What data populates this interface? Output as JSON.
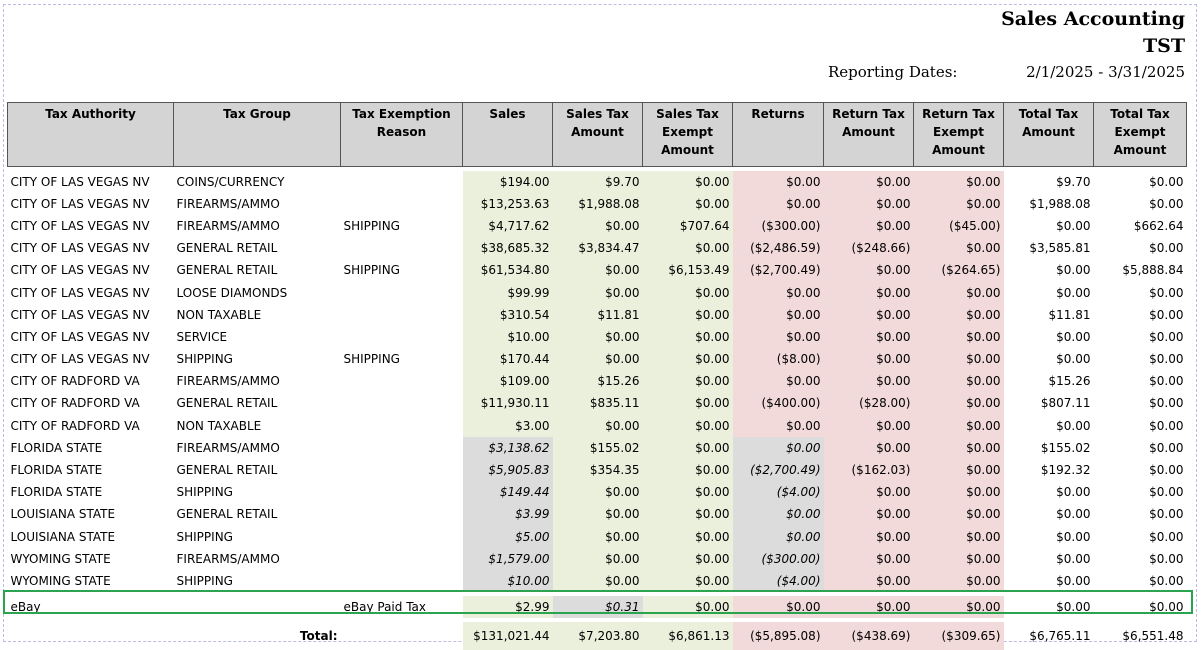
{
  "header": {
    "title": "Sales Accounting",
    "subtitle": "TST",
    "reporting_label": "Reporting Dates:",
    "reporting_dates": "2/1/2025 - 3/31/2025"
  },
  "columns": {
    "authority": "Tax Authority",
    "group": "Tax Group",
    "reason": "Tax Exemption Reason",
    "sales": "Sales",
    "sales_tax": "Sales Tax Amount",
    "sales_exempt": "Sales Tax Exempt Amount",
    "returns": "Returns",
    "return_tax": "Return Tax Amount",
    "return_exempt": "Return Tax Exempt Amount",
    "total_tax": "Total Tax Amount",
    "total_exempt": "Total Tax Exempt Amount"
  },
  "rows": [
    {
      "authority": "CITY OF LAS VEGAS NV",
      "group": "COINS/CURRENCY",
      "reason": "",
      "sales": "$194.00",
      "sales_tax": "$9.70",
      "sales_exempt": "$0.00",
      "returns": "$0.00",
      "return_tax": "$0.00",
      "return_exempt": "$0.00",
      "total_tax": "$9.70",
      "total_exempt": "$0.00",
      "style": "city"
    },
    {
      "authority": "CITY OF LAS VEGAS NV",
      "group": "FIREARMS/AMMO",
      "reason": "",
      "sales": "$13,253.63",
      "sales_tax": "$1,988.08",
      "sales_exempt": "$0.00",
      "returns": "$0.00",
      "return_tax": "$0.00",
      "return_exempt": "$0.00",
      "total_tax": "$1,988.08",
      "total_exempt": "$0.00",
      "style": "city"
    },
    {
      "authority": "CITY OF LAS VEGAS NV",
      "group": "FIREARMS/AMMO",
      "reason": "SHIPPING",
      "sales": "$4,717.62",
      "sales_tax": "$0.00",
      "sales_exempt": "$707.64",
      "returns": "($300.00)",
      "return_tax": "$0.00",
      "return_exempt": "($45.00)",
      "total_tax": "$0.00",
      "total_exempt": "$662.64",
      "style": "city"
    },
    {
      "authority": "CITY OF LAS VEGAS NV",
      "group": "GENERAL RETAIL",
      "reason": "",
      "sales": "$38,685.32",
      "sales_tax": "$3,834.47",
      "sales_exempt": "$0.00",
      "returns": "($2,486.59)",
      "return_tax": "($248.66)",
      "return_exempt": "$0.00",
      "total_tax": "$3,585.81",
      "total_exempt": "$0.00",
      "style": "city"
    },
    {
      "authority": "CITY OF LAS VEGAS NV",
      "group": "GENERAL RETAIL",
      "reason": "SHIPPING",
      "sales": "$61,534.80",
      "sales_tax": "$0.00",
      "sales_exempt": "$6,153.49",
      "returns": "($2,700.49)",
      "return_tax": "$0.00",
      "return_exempt": "($264.65)",
      "total_tax": "$0.00",
      "total_exempt": "$5,888.84",
      "style": "city"
    },
    {
      "authority": "CITY OF LAS VEGAS NV",
      "group": "LOOSE DIAMONDS",
      "reason": "",
      "sales": "$99.99",
      "sales_tax": "$0.00",
      "sales_exempt": "$0.00",
      "returns": "$0.00",
      "return_tax": "$0.00",
      "return_exempt": "$0.00",
      "total_tax": "$0.00",
      "total_exempt": "$0.00",
      "style": "city"
    },
    {
      "authority": "CITY OF LAS VEGAS NV",
      "group": "NON TAXABLE",
      "reason": "",
      "sales": "$310.54",
      "sales_tax": "$11.81",
      "sales_exempt": "$0.00",
      "returns": "$0.00",
      "return_tax": "$0.00",
      "return_exempt": "$0.00",
      "total_tax": "$11.81",
      "total_exempt": "$0.00",
      "style": "city"
    },
    {
      "authority": "CITY OF LAS VEGAS NV",
      "group": "SERVICE",
      "reason": "",
      "sales": "$10.00",
      "sales_tax": "$0.00",
      "sales_exempt": "$0.00",
      "returns": "$0.00",
      "return_tax": "$0.00",
      "return_exempt": "$0.00",
      "total_tax": "$0.00",
      "total_exempt": "$0.00",
      "style": "city"
    },
    {
      "authority": "CITY OF LAS VEGAS NV",
      "group": "SHIPPING",
      "reason": "SHIPPING",
      "sales": "$170.44",
      "sales_tax": "$0.00",
      "sales_exempt": "$0.00",
      "returns": "($8.00)",
      "return_tax": "$0.00",
      "return_exempt": "$0.00",
      "total_tax": "$0.00",
      "total_exempt": "$0.00",
      "style": "city"
    },
    {
      "authority": "CITY OF RADFORD VA",
      "group": "FIREARMS/AMMO",
      "reason": "",
      "sales": "$109.00",
      "sales_tax": "$15.26",
      "sales_exempt": "$0.00",
      "returns": "$0.00",
      "return_tax": "$0.00",
      "return_exempt": "$0.00",
      "total_tax": "$15.26",
      "total_exempt": "$0.00",
      "style": "city"
    },
    {
      "authority": "CITY OF RADFORD VA",
      "group": "GENERAL RETAIL",
      "reason": "",
      "sales": "$11,930.11",
      "sales_tax": "$835.11",
      "sales_exempt": "$0.00",
      "returns": "($400.00)",
      "return_tax": "($28.00)",
      "return_exempt": "$0.00",
      "total_tax": "$807.11",
      "total_exempt": "$0.00",
      "style": "city"
    },
    {
      "authority": "CITY OF RADFORD VA",
      "group": "NON TAXABLE",
      "reason": "",
      "sales": "$3.00",
      "sales_tax": "$0.00",
      "sales_exempt": "$0.00",
      "returns": "$0.00",
      "return_tax": "$0.00",
      "return_exempt": "$0.00",
      "total_tax": "$0.00",
      "total_exempt": "$0.00",
      "style": "city"
    },
    {
      "authority": "FLORIDA STATE",
      "group": "FIREARMS/AMMO",
      "reason": "",
      "sales": "$3,138.62",
      "sales_tax": "$155.02",
      "sales_exempt": "$0.00",
      "returns": "$0.00",
      "return_tax": "$0.00",
      "return_exempt": "$0.00",
      "total_tax": "$155.02",
      "total_exempt": "$0.00",
      "style": "state"
    },
    {
      "authority": "FLORIDA STATE",
      "group": "GENERAL RETAIL",
      "reason": "",
      "sales": "$5,905.83",
      "sales_tax": "$354.35",
      "sales_exempt": "$0.00",
      "returns": "($2,700.49)",
      "return_tax": "($162.03)",
      "return_exempt": "$0.00",
      "total_tax": "$192.32",
      "total_exempt": "$0.00",
      "style": "state"
    },
    {
      "authority": "FLORIDA STATE",
      "group": "SHIPPING",
      "reason": "",
      "sales": "$149.44",
      "sales_tax": "$0.00",
      "sales_exempt": "$0.00",
      "returns": "($4.00)",
      "return_tax": "$0.00",
      "return_exempt": "$0.00",
      "total_tax": "$0.00",
      "total_exempt": "$0.00",
      "style": "state"
    },
    {
      "authority": "LOUISIANA STATE",
      "group": "GENERAL RETAIL",
      "reason": "",
      "sales": "$3.99",
      "sales_tax": "$0.00",
      "sales_exempt": "$0.00",
      "returns": "$0.00",
      "return_tax": "$0.00",
      "return_exempt": "$0.00",
      "total_tax": "$0.00",
      "total_exempt": "$0.00",
      "style": "state"
    },
    {
      "authority": "LOUISIANA STATE",
      "group": "SHIPPING",
      "reason": "",
      "sales": "$5.00",
      "sales_tax": "$0.00",
      "sales_exempt": "$0.00",
      "returns": "$0.00",
      "return_tax": "$0.00",
      "return_exempt": "$0.00",
      "total_tax": "$0.00",
      "total_exempt": "$0.00",
      "style": "state"
    },
    {
      "authority": "WYOMING STATE",
      "group": "FIREARMS/AMMO",
      "reason": "",
      "sales": "$1,579.00",
      "sales_tax": "$0.00",
      "sales_exempt": "$0.00",
      "returns": "($300.00)",
      "return_tax": "$0.00",
      "return_exempt": "$0.00",
      "total_tax": "$0.00",
      "total_exempt": "$0.00",
      "style": "state"
    },
    {
      "authority": "WYOMING STATE",
      "group": "SHIPPING",
      "reason": "",
      "sales": "$10.00",
      "sales_tax": "$0.00",
      "sales_exempt": "$0.00",
      "returns": "($4.00)",
      "return_tax": "$0.00",
      "return_exempt": "$0.00",
      "total_tax": "$0.00",
      "total_exempt": "$0.00",
      "style": "state"
    }
  ],
  "ebay": {
    "authority": "eBay",
    "group": "",
    "reason": "eBay Paid Tax",
    "sales": "$2.99",
    "sales_tax": "$0.31",
    "sales_exempt": "$0.00",
    "returns": "$0.00",
    "return_tax": "$0.00",
    "return_exempt": "$0.00",
    "total_tax": "$0.00",
    "total_exempt": "$0.00"
  },
  "totals": {
    "label": "Total:",
    "sales": "$131,021.44",
    "sales_tax": "$7,203.80",
    "sales_exempt": "$6,861.13",
    "returns": "($5,895.08)",
    "return_tax": "($438.69)",
    "return_exempt": "($309.65)",
    "total_tax": "$6,765.11",
    "total_exempt": "$6,551.48"
  },
  "colors": {
    "sales_bg": "#eaf0dc",
    "returns_bg": "#f2d9da",
    "italic_bg": "#dcdcdc",
    "highlight_border": "#2aa44f",
    "header_bg": "#d4d4d4"
  }
}
